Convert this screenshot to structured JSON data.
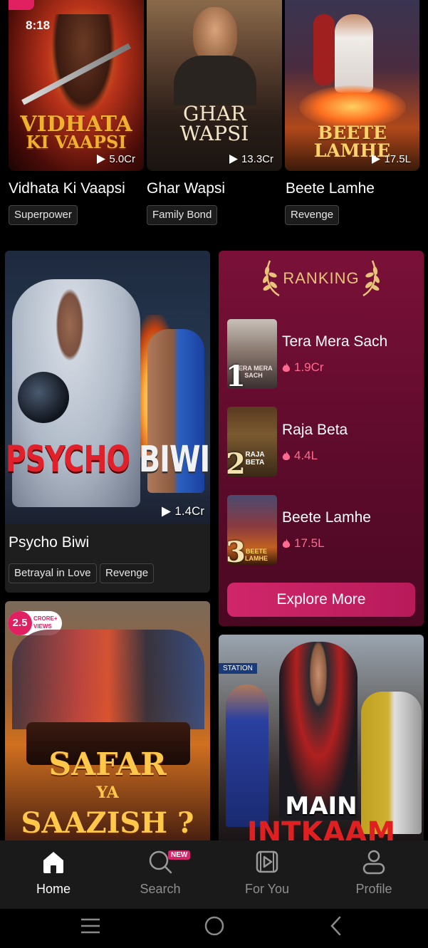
{
  "top_row": [
    {
      "title": "Vidhata Ki Vaapsi",
      "views": "5.0Cr",
      "tag": "Superpower",
      "poster_text": [
        "VIDHATA",
        "KI VAAPSI"
      ],
      "poster_color": "#f0b030"
    },
    {
      "title": "Ghar Wapsi",
      "views": "13.3Cr",
      "tag": "Family Bond",
      "poster_text": [
        "GHAR",
        "WAPSI"
      ],
      "poster_color": "#f3e6c8"
    },
    {
      "title": "Beete Lamhe",
      "views": "17.5L",
      "tag": "Revenge",
      "poster_text": [
        "BEETE LAMHE"
      ],
      "poster_color": "#ffd36a"
    }
  ],
  "status_time": "8:18",
  "featured": {
    "title": "Psycho Biwi",
    "views": "1.4Cr",
    "tags": [
      "Betrayal in Love",
      "Revenge"
    ],
    "poster_text_red": "PSYCHO",
    "poster_text_white": "BIWI"
  },
  "ranking": {
    "heading": "RANKING",
    "items": [
      {
        "rank": "1",
        "name": "Tera Mera Sach",
        "views": "1.9Cr",
        "thumb_text": "TERA MERA SACH"
      },
      {
        "rank": "2",
        "name": "Raja Beta",
        "views": "4.4L",
        "thumb_text": "RAJA BETA"
      },
      {
        "rank": "3",
        "name": "Beete Lamhe",
        "views": "17.5L",
        "thumb_text": "BEETE LAMHE"
      }
    ],
    "explore_label": "Explore More"
  },
  "bottom_cards": [
    {
      "badge_num": "2.5",
      "badge_text": "CRORE+ VIEWS",
      "poster_text": [
        "SAFAR",
        "YA",
        "SAAZISH ?"
      ]
    },
    {
      "poster_text": [
        "MAIN",
        "INTKAAM"
      ],
      "sign_text": "STATION"
    }
  ],
  "nav": {
    "items": [
      {
        "label": "Home",
        "icon": "home-icon",
        "active": true
      },
      {
        "label": "Search",
        "icon": "search-icon",
        "badge": "NEW"
      },
      {
        "label": "For You",
        "icon": "play-square-icon"
      },
      {
        "label": "Profile",
        "icon": "profile-icon"
      }
    ]
  },
  "system_nav": [
    "menu-icon",
    "home-circle-icon",
    "back-icon"
  ],
  "colors": {
    "accent": "#d0266a",
    "ranking_bg": "#6a0d31",
    "views_pink": "#ff6b8f"
  }
}
